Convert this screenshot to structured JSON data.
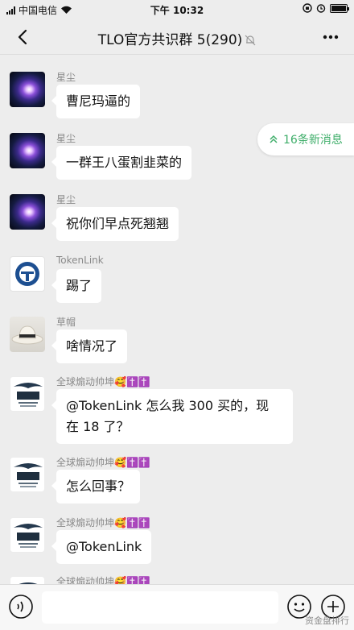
{
  "status_bar": {
    "carrier": "中国电信",
    "time": "下午 10:32"
  },
  "header": {
    "title": "TLO官方共识群 5(290)"
  },
  "new_messages": {
    "label": "16条新消息"
  },
  "messages": [
    {
      "sender": "星尘",
      "text": "曹尼玛逼的"
    },
    {
      "sender": "星尘",
      "text": "一群王八蛋割韭菜的"
    },
    {
      "sender": "星尘",
      "text": "祝你们早点死翘翘"
    },
    {
      "sender": "TokenLink",
      "text": "踢了"
    },
    {
      "sender": "草帽",
      "text": "啥情况了"
    },
    {
      "sender": "全球煽动帅坤🥰✝️✝️",
      "text_lines": [
        "@TokenLink 怎么我 300 买的，现",
        "在 18 了？"
      ]
    },
    {
      "sender": "全球煽动帅坤🥰✝️✝️",
      "text": "怎么回事？"
    },
    {
      "sender": "全球煽动帅坤🥰✝️✝️",
      "text": "@TokenLink"
    },
    {
      "sender": "全球煽动帅坤🥰✝️✝️"
    }
  ],
  "watermark": "资金盘排行",
  "colors": {
    "accent": "#3fae6a",
    "background": "#ededed",
    "bubble": "#ffffff"
  }
}
